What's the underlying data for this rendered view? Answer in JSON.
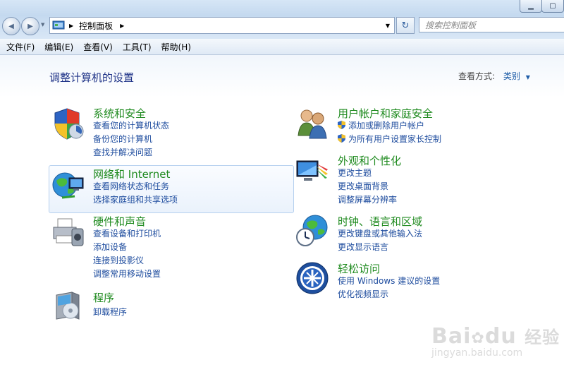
{
  "window": {
    "minimize_glyph": "▁",
    "maximize_glyph": "▢"
  },
  "address": {
    "back_glyph": "◀",
    "forward_glyph": "▶",
    "breadcrumb": "控制面板",
    "separator_glyph": "▶",
    "dropdown_glyph": "▼",
    "refresh_glyph": "↻",
    "search_placeholder": "搜索控制面板"
  },
  "menu": {
    "items": [
      "文件(F)",
      "编辑(E)",
      "查看(V)",
      "工具(T)",
      "帮助(H)"
    ]
  },
  "main": {
    "title": "调整计算机的设置",
    "view_label": "查看方式:",
    "view_value": "类别",
    "view_dropdown_glyph": "▼"
  },
  "categories": {
    "system": {
      "title": "系统和安全",
      "links": [
        "查看您的计算机状态",
        "备份您的计算机",
        "查找并解决问题"
      ]
    },
    "network": {
      "title": "网络和 Internet",
      "links": [
        "查看网络状态和任务",
        "选择家庭组和共享选项"
      ]
    },
    "hardware": {
      "title": "硬件和声音",
      "links": [
        "查看设备和打印机",
        "添加设备",
        "连接到投影仪",
        "调整常用移动设置"
      ]
    },
    "programs": {
      "title": "程序",
      "links": [
        "卸载程序"
      ]
    },
    "users": {
      "title": "用户帐户和家庭安全",
      "links": [
        "添加或删除用户帐户",
        "为所有用户设置家长控制"
      ]
    },
    "appearance": {
      "title": "外观和个性化",
      "links": [
        "更改主题",
        "更改桌面背景",
        "调整屏幕分辨率"
      ]
    },
    "clock": {
      "title": "时钟、语言和区域",
      "links": [
        "更改键盘或其他输入法",
        "更改显示语言"
      ]
    },
    "ease": {
      "title": "轻松访问",
      "links": [
        "使用 Windows 建议的设置",
        "优化视频显示"
      ]
    }
  },
  "watermark": {
    "logo_text": "Bai",
    "logo_text2": "du",
    "logo_cn": "经验",
    "url": "jingyan.baidu.com"
  },
  "colors": {
    "title_blue": "#1e3287",
    "category_green": "#1e8a1e",
    "link_blue": "#1e4c9e"
  }
}
